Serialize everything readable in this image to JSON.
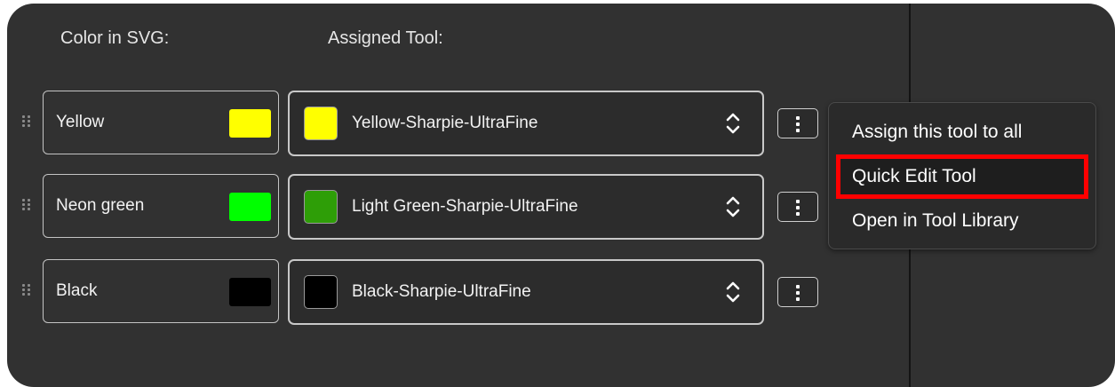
{
  "headers": {
    "color_in_svg": "Color in SVG:",
    "assigned_tool": "Assigned Tool:"
  },
  "rows": [
    {
      "color_name": "Yellow",
      "color_hex": "#ffff00",
      "tool_name": "Yellow-Sharpie-UltraFine",
      "tool_hex": "#ffff00"
    },
    {
      "color_name": "Neon green",
      "color_hex": "#00ff00",
      "tool_name": "Light Green-Sharpie-UltraFine",
      "tool_hex": "#2e9e07"
    },
    {
      "color_name": "Black",
      "color_hex": "#000000",
      "tool_name": "Black-Sharpie-UltraFine",
      "tool_hex": "#000000"
    }
  ],
  "context_menu": {
    "items": [
      {
        "label": "Assign this tool to all"
      },
      {
        "label": "Quick Edit Tool"
      },
      {
        "label": "Open in Tool Library"
      }
    ],
    "highlighted_index": 1,
    "highlight_color": "#ff0000"
  },
  "icons": {
    "drag_handle": "drag-handle-icon",
    "select_arrows": "chevron-up-down-icon",
    "more_options": "kebab-menu-icon"
  }
}
